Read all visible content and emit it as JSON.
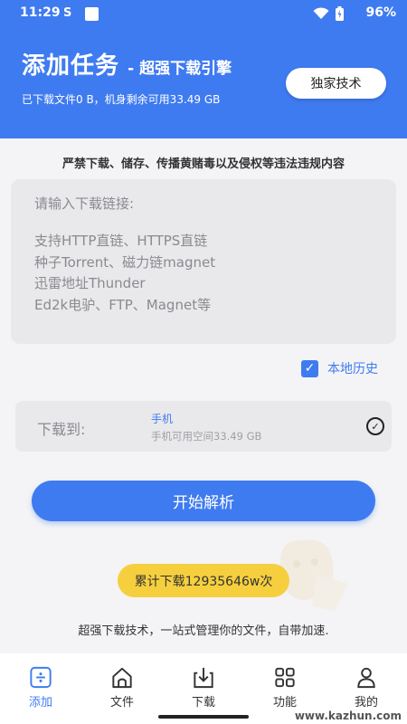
{
  "status_bar": {
    "time": "11:29",
    "signal_text": "S",
    "battery": "96%"
  },
  "header": {
    "title": "添加任务",
    "subtitle": "- 超强下载引擎",
    "storage_info": "已下载文件0 B，机身剩余可用33.49 GB",
    "tech_button": "独家技术",
    "bg_color": "#3f7bf0"
  },
  "warning": "严禁下载、储存、传播黄赌毒以及侵权等违法违规内容",
  "url_input": {
    "placeholder_title": "请输入下载链接:",
    "placeholder_lines": [
      "支持HTTP直链、HTTPS直链",
      "种子Torrent、磁力链magnet",
      "迅雷地址Thunder",
      "Ed2k电驴、FTP、Magnet等"
    ]
  },
  "local_history": {
    "label": "本地历史",
    "checked": true
  },
  "destination": {
    "label": "下载到:",
    "name": "手机",
    "space": "手机可用空间33.49 GB"
  },
  "start_button": "开始解析",
  "counter": "累计下载12935646w次",
  "tagline": "超强下载技术，一站式管理你的文件，自带加速.",
  "tabs": [
    {
      "label": "添加",
      "icon": "add-box-icon",
      "active": true
    },
    {
      "label": "文件",
      "icon": "home-icon",
      "active": false
    },
    {
      "label": "下载",
      "icon": "download-icon",
      "active": false
    },
    {
      "label": "功能",
      "icon": "grid-icon",
      "active": false
    },
    {
      "label": "我的",
      "icon": "user-icon",
      "active": false
    }
  ],
  "site_watermark": "www.kazhun.com"
}
